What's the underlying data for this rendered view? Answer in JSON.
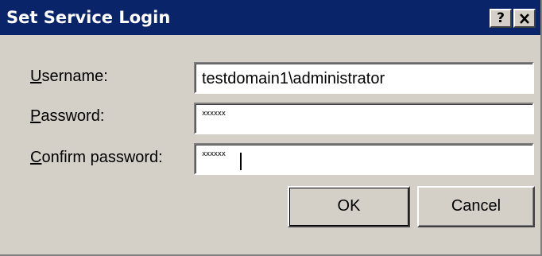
{
  "dialog": {
    "title": "Set Service Login",
    "help_button": "?",
    "close_button": "close"
  },
  "fields": {
    "username": {
      "label_mnemonic": "U",
      "label_rest": "sername:",
      "value": "testdomain1\\administrator"
    },
    "password": {
      "label_mnemonic": "P",
      "label_rest": "assword:",
      "masked_value": "xxxxxx"
    },
    "confirm": {
      "label_mnemonic": "C",
      "label_rest": "onfirm password:",
      "masked_value": "xxxxxx"
    }
  },
  "buttons": {
    "ok": "OK",
    "cancel": "Cancel"
  },
  "colors": {
    "titlebar": "#0a246a",
    "dialog_face": "#d4d0c8"
  }
}
